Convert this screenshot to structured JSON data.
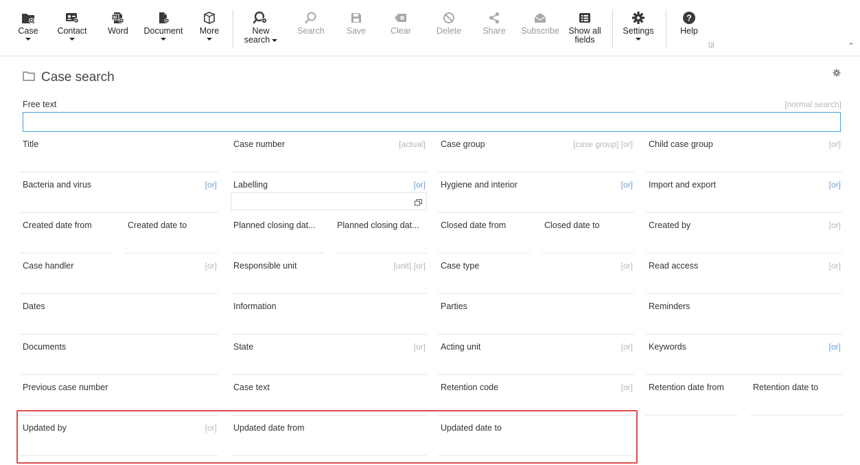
{
  "ribbon": {
    "buttons": [
      {
        "id": "case",
        "label": "Case",
        "caret": true,
        "disabled": false,
        "icon": "folder-icon"
      },
      {
        "id": "contact",
        "label": "Contact",
        "caret": true,
        "disabled": false,
        "icon": "contact-card-icon"
      },
      {
        "id": "word",
        "label": "Word",
        "caret": false,
        "disabled": false,
        "icon": "word-document-icon"
      },
      {
        "id": "document",
        "label": "Document",
        "caret": true,
        "disabled": false,
        "icon": "document-add-icon"
      },
      {
        "id": "more",
        "label": "More",
        "caret": true,
        "disabled": false,
        "icon": "box-icon"
      },
      {
        "id": "new-search",
        "label": "New",
        "label2": "search",
        "caret": true,
        "disabled": false,
        "icon": "new-search-icon"
      },
      {
        "id": "search",
        "label": "Search",
        "caret": false,
        "disabled": true,
        "icon": "search-icon"
      },
      {
        "id": "save",
        "label": "Save",
        "caret": false,
        "disabled": true,
        "icon": "save-icon"
      },
      {
        "id": "clear",
        "label": "Clear",
        "caret": false,
        "disabled": true,
        "icon": "clear-icon"
      },
      {
        "id": "delete",
        "label": "Delete",
        "caret": false,
        "disabled": true,
        "icon": "delete-icon"
      },
      {
        "id": "share",
        "label": "Share",
        "caret": false,
        "disabled": true,
        "icon": "share-icon"
      },
      {
        "id": "subscribe",
        "label": "Subscribe",
        "caret": false,
        "disabled": true,
        "icon": "subscribe-icon"
      },
      {
        "id": "show-all-fields",
        "label": "Show all",
        "label2": "fields",
        "caret": false,
        "disabled": false,
        "icon": "list-icon"
      },
      {
        "id": "settings",
        "label": "Settings",
        "caret": true,
        "disabled": false,
        "icon": "gear-icon"
      },
      {
        "id": "help",
        "label": "Help",
        "caret": false,
        "disabled": false,
        "icon": "help-icon"
      }
    ]
  },
  "page": {
    "title": "Case search",
    "free_text_label": "Free text",
    "free_text_hint": "[normal search]",
    "free_text_value": ""
  },
  "colors": {
    "accent": "#3fa0d8",
    "highlight": "#e24c4c",
    "hint": "#b6b6b6",
    "hint_blue": "#6a9ecf",
    "icon_dark": "#3a3a3a",
    "icon_disabled": "#a9a9a9"
  },
  "fields": [
    {
      "label": "Title",
      "hint": ""
    },
    {
      "label": "Case number",
      "hint": "[actual]"
    },
    {
      "label": "Case group",
      "hint": "[case group] [or]"
    },
    {
      "label": "Child case group",
      "hint": "[or]"
    },
    {
      "label": "Bacteria and virus",
      "hint": "[or]"
    },
    {
      "label": "Labelling",
      "hint": "[or]"
    },
    {
      "label": "Hygiene and interior",
      "hint": "[or]"
    },
    {
      "label": "Import and export",
      "hint": "[or]"
    },
    {
      "label": "Created date from",
      "hint": ""
    },
    {
      "label": "Created date to",
      "hint": ""
    },
    {
      "label": "Planned closing dat...",
      "hint": ""
    },
    {
      "label": "Planned closing dat...",
      "hint": ""
    },
    {
      "label": "Closed date from",
      "hint": ""
    },
    {
      "label": "Closed date to",
      "hint": ""
    },
    {
      "label": "Created by",
      "hint": "[or]"
    },
    {
      "label": "Case handler",
      "hint": "[or]"
    },
    {
      "label": "Responsible unit",
      "hint": "[unit] [or]"
    },
    {
      "label": "Case type",
      "hint": "[or]"
    },
    {
      "label": "Read access",
      "hint": "[or]"
    },
    {
      "label": "Dates",
      "hint": ""
    },
    {
      "label": "Information",
      "hint": ""
    },
    {
      "label": "Parties",
      "hint": ""
    },
    {
      "label": "Reminders",
      "hint": ""
    },
    {
      "label": "Documents",
      "hint": ""
    },
    {
      "label": "State",
      "hint": "[or]"
    },
    {
      "label": "Acting unit",
      "hint": "[or]"
    },
    {
      "label": "Keywords",
      "hint": "[or]"
    },
    {
      "label": "Previous case number",
      "hint": ""
    },
    {
      "label": "Case text",
      "hint": ""
    },
    {
      "label": "Retention code",
      "hint": "[or]"
    },
    {
      "label": "Retention date from",
      "hint": ""
    },
    {
      "label": "Retention date to",
      "hint": ""
    },
    {
      "label": "Updated by",
      "hint": "[or]"
    },
    {
      "label": "Updated date from",
      "hint": ""
    },
    {
      "label": "Updated date to",
      "hint": ""
    }
  ]
}
